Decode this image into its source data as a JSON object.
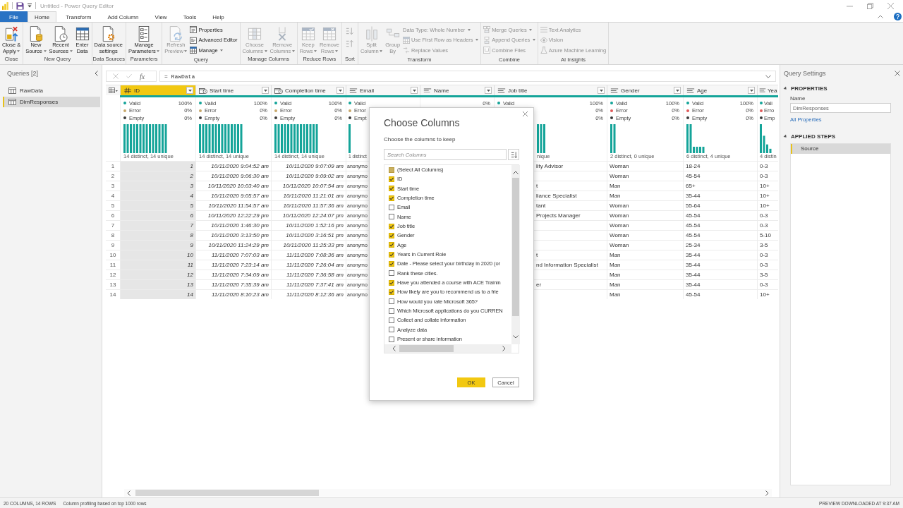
{
  "title_bar": {
    "title": "Untitled - Power Query Editor"
  },
  "ribbon_tabs": [
    {
      "label": "File",
      "kind": "file",
      "selected": false
    },
    {
      "label": "Home",
      "kind": "tab",
      "selected": true
    },
    {
      "label": "Transform",
      "kind": "tab",
      "selected": false
    },
    {
      "label": "Add Column",
      "kind": "tab",
      "selected": false
    },
    {
      "label": "View",
      "kind": "tab",
      "selected": false
    },
    {
      "label": "Tools",
      "kind": "tab",
      "selected": false
    },
    {
      "label": "Help",
      "kind": "tab",
      "selected": false
    }
  ],
  "ribbon": [
    {
      "label": "Close",
      "items": [
        {
          "kind": "large",
          "lines": [
            "Close &",
            "Apply"
          ],
          "dropdown": true,
          "disabled": false
        }
      ]
    },
    {
      "label": "New Query",
      "items": [
        {
          "kind": "large",
          "lines": [
            "New",
            "Source"
          ],
          "dropdown": true,
          "disabled": false
        },
        {
          "kind": "large",
          "lines": [
            "Recent",
            "Sources"
          ],
          "dropdown": true,
          "disabled": false
        },
        {
          "kind": "large",
          "lines": [
            "Enter",
            "Data"
          ],
          "dropdown": false,
          "disabled": false
        }
      ]
    },
    {
      "label": "Data Sources",
      "items": [
        {
          "kind": "large",
          "lines": [
            "Data source",
            "settings"
          ],
          "dropdown": false,
          "disabled": false
        }
      ]
    },
    {
      "label": "Parameters",
      "items": [
        {
          "kind": "large",
          "lines": [
            "Manage",
            "Parameters"
          ],
          "dropdown": true,
          "disabled": false
        }
      ]
    },
    {
      "label": "Query",
      "items": [
        {
          "kind": "large",
          "lines": [
            "Refresh",
            "Preview"
          ],
          "dropdown": true,
          "disabled": true
        },
        {
          "kind": "stack",
          "items": [
            {
              "kind": "small",
              "label": "Properties",
              "dropdown": false,
              "disabled": false
            },
            {
              "kind": "small",
              "label": "Advanced Editor",
              "dropdown": false,
              "disabled": false
            },
            {
              "kind": "small",
              "label": "Manage",
              "dropdown": true,
              "disabled": false
            }
          ]
        }
      ]
    },
    {
      "label": "Manage Columns",
      "items": [
        {
          "kind": "large",
          "lines": [
            "Choose",
            "Columns"
          ],
          "dropdown": true,
          "disabled": true
        },
        {
          "kind": "large",
          "lines": [
            "Remove",
            "Columns"
          ],
          "dropdown": true,
          "disabled": true
        }
      ]
    },
    {
      "label": "Reduce Rows",
      "items": [
        {
          "kind": "large",
          "lines": [
            "Keep",
            "Rows"
          ],
          "dropdown": true,
          "disabled": true
        },
        {
          "kind": "large",
          "lines": [
            "Remove",
            "Rows"
          ],
          "dropdown": true,
          "disabled": true
        }
      ]
    },
    {
      "label": "Sort",
      "items": [
        {
          "kind": "stack",
          "items": [
            {
              "kind": "icon",
              "disabled": true
            },
            {
              "kind": "icon",
              "disabled": true
            }
          ]
        }
      ]
    },
    {
      "label": "Transform",
      "items": [
        {
          "kind": "large",
          "lines": [
            "Split",
            "Column"
          ],
          "dropdown": true,
          "disabled": true
        },
        {
          "kind": "large",
          "lines": [
            "Group",
            "By"
          ],
          "dropdown": false,
          "disabled": true
        },
        {
          "kind": "stack",
          "items": [
            {
              "kind": "small",
              "label": "Data Type: Whole Number",
              "dropdown": true,
              "disabled": true
            },
            {
              "kind": "small",
              "label": "Use First Row as Headers",
              "dropdown": true,
              "disabled": true
            },
            {
              "kind": "small",
              "label": "Replace Values",
              "dropdown": false,
              "disabled": true
            }
          ]
        }
      ]
    },
    {
      "label": "Combine",
      "items": [
        {
          "kind": "stack",
          "items": [
            {
              "kind": "small",
              "label": "Merge Queries",
              "dropdown": true,
              "disabled": true
            },
            {
              "kind": "small",
              "label": "Append Queries",
              "dropdown": true,
              "disabled": true
            },
            {
              "kind": "small",
              "label": "Combine Files",
              "dropdown": false,
              "disabled": true
            }
          ]
        }
      ]
    },
    {
      "label": "AI Insights",
      "items": [
        {
          "kind": "stack",
          "items": [
            {
              "kind": "small",
              "label": "Text Analytics",
              "dropdown": false,
              "disabled": true
            },
            {
              "kind": "small",
              "label": "Vision",
              "dropdown": false,
              "disabled": true
            },
            {
              "kind": "small",
              "label": "Azure Machine Learning",
              "dropdown": false,
              "disabled": true
            }
          ]
        }
      ]
    }
  ],
  "queries": {
    "title": "Queries [2]",
    "items": [
      {
        "label": "RawData",
        "selected": false
      },
      {
        "label": "DimResponses",
        "selected": true
      }
    ]
  },
  "formula_bar": {
    "fx": "fx",
    "formula": "= RawData"
  },
  "table": {
    "columns": [
      {
        "name": "ID",
        "kind": "number",
        "selected": true,
        "stats": [
          {
            "label": "Valid",
            "value": "100%",
            "color": "#14a499"
          },
          {
            "label": "Error",
            "value": "0%",
            "color": "#c8a86b"
          },
          {
            "label": "Empty",
            "value": "0%",
            "color": "#3a3a3a"
          }
        ],
        "summary": "14 distinct, 14 unique"
      },
      {
        "name": "Start time",
        "kind": "datetime",
        "selected": false,
        "stats": [
          {
            "label": "Valid",
            "value": "100%",
            "color": "#14a499"
          },
          {
            "label": "Error",
            "value": "0%",
            "color": "#c8a86b"
          },
          {
            "label": "Empty",
            "value": "0%",
            "color": "#3a3a3a"
          }
        ],
        "summary": "14 distinct, 14 unique"
      },
      {
        "name": "Completion time",
        "kind": "datetime",
        "selected": false,
        "stats": [
          {
            "label": "Valid",
            "value": "100%",
            "color": "#14a499"
          },
          {
            "label": "Error",
            "value": "0%",
            "color": "#c8a86b"
          },
          {
            "label": "Empty",
            "value": "0%",
            "color": "#3a3a3a"
          }
        ],
        "summary": "14 distinct, 14 unique"
      },
      {
        "name": "Email",
        "kind": "text",
        "selected": false,
        "stats": [
          {
            "label": "Valid",
            "color": "#14a499"
          },
          {
            "label": "Error",
            "color": "#c8a86b"
          },
          {
            "label": "Empt",
            "color": "#3a3a3a"
          }
        ],
        "summary": "1 distinct"
      },
      {
        "name": "Name",
        "kind": "any",
        "selected": false,
        "stats": [
          {
            "value": "0%"
          }
        ]
      },
      {
        "name": "Job title",
        "kind": "text",
        "selected": false,
        "stats": [
          {
            "label": "Valid",
            "value": "100%",
            "color": "#14a499"
          },
          {
            "value": "0%"
          },
          {
            "value": "0%"
          }
        ],
        "summary": "nique"
      },
      {
        "name": "Gender",
        "kind": "text",
        "selected": false,
        "stats": [
          {
            "label": "Valid",
            "value": "100%",
            "color": "#14a499"
          },
          {
            "label": "Error",
            "value": "0%",
            "color": "#e05a5a"
          },
          {
            "label": "Empty",
            "value": "0%",
            "color": "#3a3a3a"
          }
        ],
        "summary": "2 distinct, 0 unique"
      },
      {
        "name": "Age",
        "kind": "text",
        "selected": false,
        "stats": [
          {
            "label": "Valid",
            "value": "100%",
            "color": "#14a499"
          },
          {
            "label": "Error",
            "value": "0%",
            "color": "#e05a5a"
          },
          {
            "label": "Empty",
            "value": "0%",
            "color": "#3a3a3a"
          }
        ],
        "summary": "6 distinct, 4 unique"
      },
      {
        "name": "Yea",
        "kind": "text",
        "selected": false,
        "stats": [
          {
            "label": "Vali",
            "color": "#14a499"
          },
          {
            "label": "Erro",
            "color": "#e05a5a"
          },
          {
            "label": "Emp",
            "color": "#3a3a3a"
          }
        ],
        "summary": "4 distin"
      }
    ],
    "rows": [
      {
        "number": "1",
        "cells": [
          "1",
          "10/11/2020 9:04:52 am",
          "10/11/2020 9:07:09 am",
          "anonymo",
          null,
          "lity Advisor",
          "Woman",
          "18-24",
          "0-3"
        ]
      },
      {
        "number": "2",
        "cells": [
          "2",
          "10/11/2020 9:06:30 am",
          "10/11/2020 9:09:02 am",
          "anonymo",
          null,
          null,
          "Woman",
          "45-54",
          "0-3"
        ]
      },
      {
        "number": "3",
        "cells": [
          "3",
          "10/11/2020 10:03:40 am",
          "10/11/2020 10:07:54 am",
          "anonymo",
          null,
          "t",
          "Man",
          "65+",
          "10+"
        ]
      },
      {
        "number": "4",
        "cells": [
          "4",
          "10/11/2020 9:05:57 am",
          "10/11/2020 11:21:01 am",
          "anonymo",
          null,
          "liance Specialist",
          "Man",
          "35-44",
          "10+"
        ]
      },
      {
        "number": "5",
        "cells": [
          "5",
          "10/11/2020 11:54:57 am",
          "10/11/2020 11:57:36 am",
          "anonymo",
          null,
          "tant",
          "Woman",
          "55-64",
          "10+"
        ]
      },
      {
        "number": "6",
        "cells": [
          "6",
          "10/11/2020 12:22:29 pm",
          "10/11/2020 12:24:07 pm",
          "anonymo",
          null,
          "Projects Manager",
          "Woman",
          "45-54",
          "0-3"
        ]
      },
      {
        "number": "7",
        "cells": [
          "7",
          "10/11/2020 1:46:30 pm",
          "10/11/2020 1:52:16 pm",
          "anonymo",
          null,
          null,
          "Woman",
          "45-54",
          "0-3"
        ]
      },
      {
        "number": "8",
        "cells": [
          "8",
          "10/11/2020 3:13:50 pm",
          "10/11/2020 3:16:51 pm",
          "anonymo",
          null,
          null,
          "Woman",
          "45-54",
          "5-10"
        ]
      },
      {
        "number": "9",
        "cells": [
          "9",
          "10/11/2020 11:24:29 pm",
          "10/11/2020 11:25:33 pm",
          "anonymo",
          null,
          null,
          "Woman",
          "25-34",
          "3-5"
        ]
      },
      {
        "number": "10",
        "cells": [
          "10",
          "11/11/2020 7:07:03 am",
          "11/11/2020 7:08:36 am",
          "anonymo",
          null,
          "t",
          "Man",
          "35-44",
          "0-3"
        ]
      },
      {
        "number": "11",
        "cells": [
          "11",
          "11/11/2020 7:23:14 am",
          "11/11/2020 7:26:04 am",
          "anonymo",
          null,
          "nd Information Specialist",
          "Man",
          "35-44",
          "0-3"
        ]
      },
      {
        "number": "12",
        "cells": [
          "12",
          "11/11/2020 7:34:09 am",
          "11/11/2020 7:36:58 am",
          "anonymo",
          null,
          null,
          "Man",
          "35-44",
          "3-5"
        ]
      },
      {
        "number": "13",
        "cells": [
          "13",
          "11/11/2020 7:35:39 am",
          "11/11/2020 7:37:41 am",
          "anonymo",
          null,
          "er",
          "Man",
          "35-44",
          "0-3"
        ]
      },
      {
        "number": "14",
        "cells": [
          "14",
          "11/11/2020 8:10:23 am",
          "11/11/2020 8:12:36 am",
          "anonymo",
          null,
          null,
          "Man",
          "45-54",
          "10+"
        ]
      }
    ]
  },
  "choose_columns": {
    "title": "Choose Columns",
    "subtitle": "Choose the columns to keep",
    "search": {
      "placeholder": "Search Columns"
    },
    "select_all": {
      "label": "(Select All Columns)",
      "indeterminate": true
    },
    "columns": [
      {
        "label": "ID",
        "checked": true
      },
      {
        "label": "Start time",
        "checked": true
      },
      {
        "label": "Completion time",
        "checked": true
      },
      {
        "label": "Email",
        "checked": false
      },
      {
        "label": "Name",
        "checked": false
      },
      {
        "label": "Job title",
        "checked": true
      },
      {
        "label": "Gender",
        "checked": true
      },
      {
        "label": "Age",
        "checked": true
      },
      {
        "label": "Years in Current Role",
        "checked": true
      },
      {
        "label": "Date - Please select your birthday in 2020 (or",
        "checked": true
      },
      {
        "label": "Rank these cities.",
        "checked": false
      },
      {
        "label": "Have you attended a course with ACE Trainin",
        "checked": true
      },
      {
        "label": "How likely are you to recommend us to a frie",
        "checked": true
      },
      {
        "label": "How would you rate Microsoft 365?",
        "checked": false
      },
      {
        "label": "Which Microsoft applications do you CURREN",
        "checked": false
      },
      {
        "label": "Collect and collate information",
        "checked": false
      },
      {
        "label": "Analyze data",
        "checked": false
      },
      {
        "label": "Present or share information",
        "checked": false
      }
    ],
    "buttons": [
      {
        "label": "OK",
        "kind": "primary"
      },
      {
        "label": "Cancel",
        "kind": "secondary"
      }
    ]
  },
  "query_settings": {
    "title": "Query Settings",
    "properties": {
      "heading": "PROPERTIES",
      "expanded": true,
      "name_label": "Name",
      "name_value": "DimResponses",
      "link": "All Properties"
    },
    "applied_steps": {
      "heading": "APPLIED STEPS",
      "expanded": true,
      "steps": [
        {
          "label": "Source",
          "selected": true
        }
      ]
    }
  },
  "status_bar": {
    "left": [
      "20 COLUMNS, 14 ROWS",
      "Column profiling based on top 1000 rows"
    ],
    "right": "PREVIEW DOWNLOADED AT 9:37 AM"
  }
}
